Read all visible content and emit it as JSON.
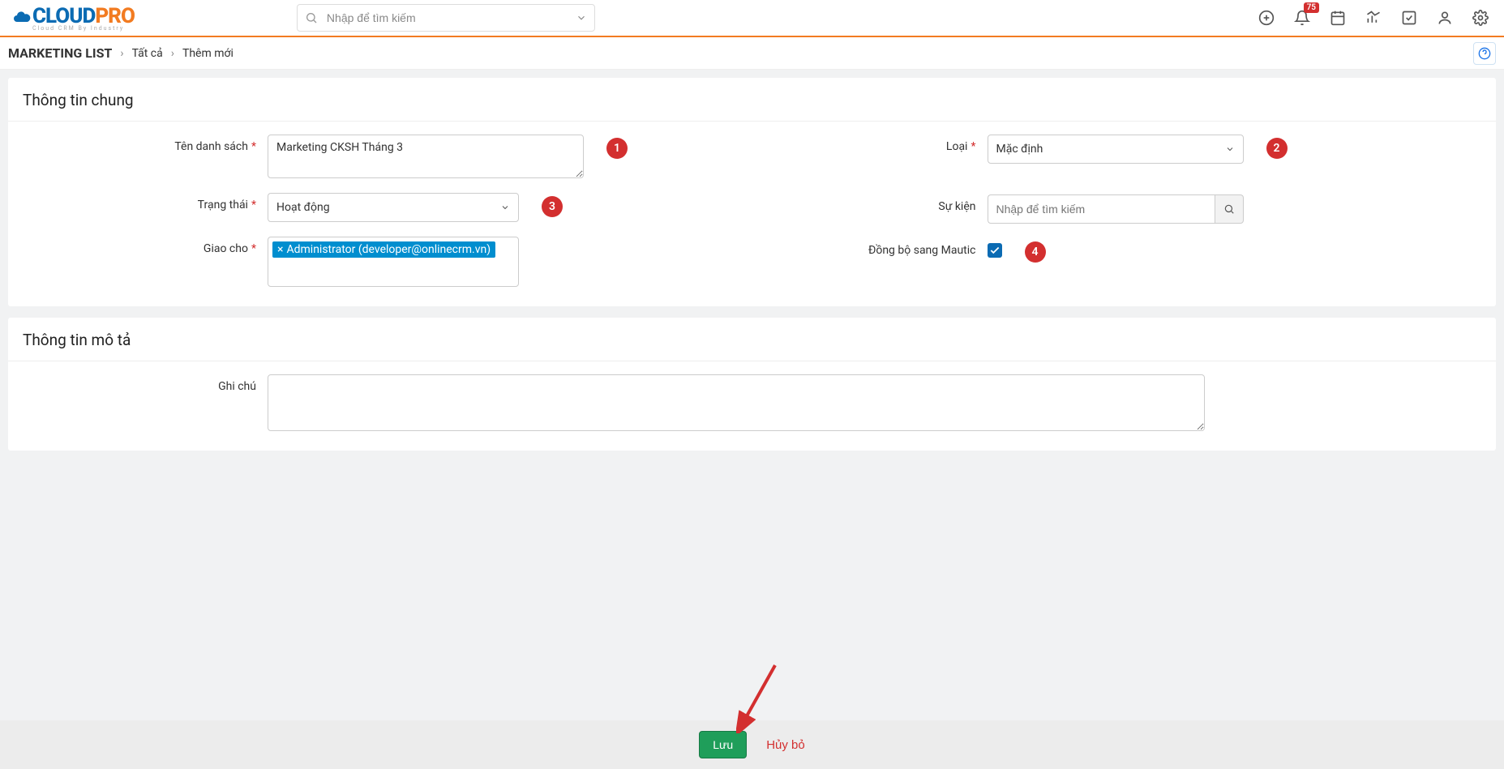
{
  "header": {
    "logo_left": "CLOUD",
    "logo_right": "PRO",
    "logo_sub": "Cloud CRM By Industry",
    "search_placeholder": "Nhập để tìm kiếm",
    "notification_badge": "75"
  },
  "breadcrumb": {
    "root": "MARKETING LIST",
    "link1": "Tất cả",
    "current": "Thêm mới"
  },
  "panel1": {
    "title": "Thông tin chung",
    "fields": {
      "name_label": "Tên danh sách",
      "name_value": "Marketing CKSH Tháng 3",
      "type_label": "Loại",
      "type_value": "Mặc định",
      "status_label": "Trạng thái",
      "status_value": "Hoạt động",
      "event_label": "Sự kiện",
      "event_placeholder": "Nhập để tìm kiếm",
      "assigned_label": "Giao cho",
      "assigned_tag": "Administrator (developer@onlinecrm.vn)",
      "sync_label": "Đồng bộ sang Mautic"
    },
    "bubbles": {
      "b1": "1",
      "b2": "2",
      "b3": "3",
      "b4": "4"
    }
  },
  "panel2": {
    "title": "Thông tin mô tả",
    "notes_label": "Ghi chú"
  },
  "footer": {
    "save": "Lưu",
    "cancel": "Hủy bỏ"
  }
}
